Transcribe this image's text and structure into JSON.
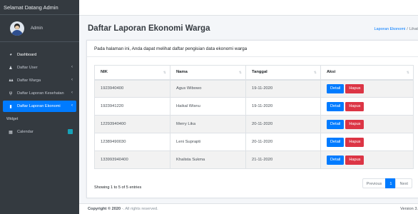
{
  "sidebar": {
    "brand": "Selamat Datang Admin",
    "user_name": "Admin",
    "items": [
      {
        "label": "Dashboard",
        "icon": "dashboard-icon",
        "glyph": "◕"
      },
      {
        "label": "Daftar User",
        "icon": "user-icon",
        "glyph": "♟"
      },
      {
        "label": "Daftar Warga",
        "icon": "users-icon",
        "glyph": "♟♟"
      },
      {
        "label": "Daftar Laporan Kesehatan",
        "icon": "heartbeat-icon",
        "glyph": "ψ"
      },
      {
        "label": "Daftar Laporan Ekonomi",
        "icon": "book-icon",
        "glyph": "▮"
      }
    ],
    "header_widget": "Widget",
    "calendar": {
      "label": "Calendar",
      "icon": "calendar-icon",
      "glyph": "▦"
    }
  },
  "page": {
    "title": "Daftar Laporan Ekonomi Warga",
    "breadcrumb": [
      "Laporan Ekonomi",
      "/",
      "Lihat"
    ],
    "description": "Pada halaman ini, Anda dapat melihat daftar pengisian data ekonomi warga"
  },
  "table": {
    "columns": [
      "NIK",
      "Nama",
      "Tanggal",
      "Aksi"
    ],
    "rows": [
      {
        "nik": "1923940400",
        "nama": "Agus Wibowo",
        "tanggal": "19-11-2020"
      },
      {
        "nik": "1923941220",
        "nama": "Haikal Wisnu",
        "tanggal": "19-11-2020"
      },
      {
        "nik": "12293940400",
        "nama": "Merry Lika",
        "tanggal": "20-11-2020"
      },
      {
        "nik": "12389490030",
        "nama": "Leni Suprapti",
        "tanggal": "20-11-2020"
      },
      {
        "nik": "133993940400",
        "nama": "Khalista Sukma",
        "tanggal": "21-11-2020"
      }
    ],
    "detail_label": "Detail",
    "hapus_label": "Hapus"
  },
  "pagination": {
    "info": "Showing 1 to 5 of 5 entries",
    "previous": "Previous",
    "page": "1",
    "next": "Next"
  },
  "footer": {
    "copyright": "Copyright © 2020",
    "rights": "-. All rights reserved.",
    "version": "Version 3."
  },
  "colors": {
    "sidebar_bg": "#343a40",
    "primary": "#007bff",
    "danger": "#dc3545",
    "page_bg": "#f4f6f9"
  }
}
